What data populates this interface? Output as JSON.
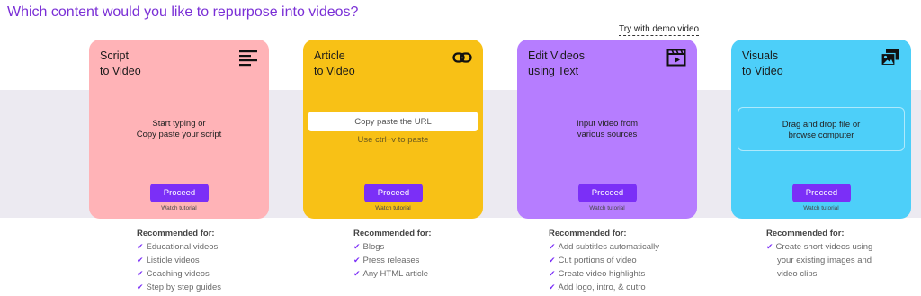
{
  "heading": "Which content would you like to repurpose into videos?",
  "demo_link": "Try with demo video",
  "colors": {
    "accent": "#7b2ff7",
    "heading": "#7a2fd6",
    "band": "#eceaf1"
  },
  "cards": [
    {
      "title_line1": "Script",
      "title_line2": "to Video",
      "color": "#ffb3b7",
      "icon": "text-lines-icon",
      "body_line1": "Start typing or",
      "body_line2": "Copy paste your script",
      "proceed": "Proceed",
      "tutorial": "Watch tutorial",
      "rec_title": "Recommended for:",
      "rec": [
        "Educational videos",
        "Listicle videos",
        "Coaching videos",
        "Step by step guides"
      ]
    },
    {
      "title_line1": "Article",
      "title_line2": "to Video",
      "color": "#f8c116",
      "icon": "link-icon",
      "input_placeholder": "Copy paste the URL",
      "hint": "Use ctrl+v to paste",
      "proceed": "Proceed",
      "tutorial": "Watch tutorial",
      "rec_title": "Recommended for:",
      "rec": [
        "Blogs",
        "Press releases",
        "Any HTML article"
      ]
    },
    {
      "title_line1": "Edit Videos",
      "title_line2": "using Text",
      "color": "#b67dff",
      "icon": "clapperboard-icon",
      "body_line1": "Input video from",
      "body_line2": "various sources",
      "proceed": "Proceed",
      "tutorial": "Watch tutorial",
      "rec_title": "Recommended for:",
      "rec": [
        "Add subtitles automatically",
        "Cut portions of video",
        "Create video highlights",
        "Add logo, intro, & outro"
      ]
    },
    {
      "title_line1": "Visuals",
      "title_line2": "to Video",
      "color": "#4dcff9",
      "icon": "images-icon",
      "body_line1": "Drag and drop file or",
      "body_line2": "browse computer",
      "proceed": "Proceed",
      "tutorial": "Watch tutorial",
      "rec_title": "Recommended for:",
      "rec": [
        "Create short videos using"
      ],
      "rec_cont": [
        "your existing images and",
        "video clips"
      ]
    }
  ]
}
